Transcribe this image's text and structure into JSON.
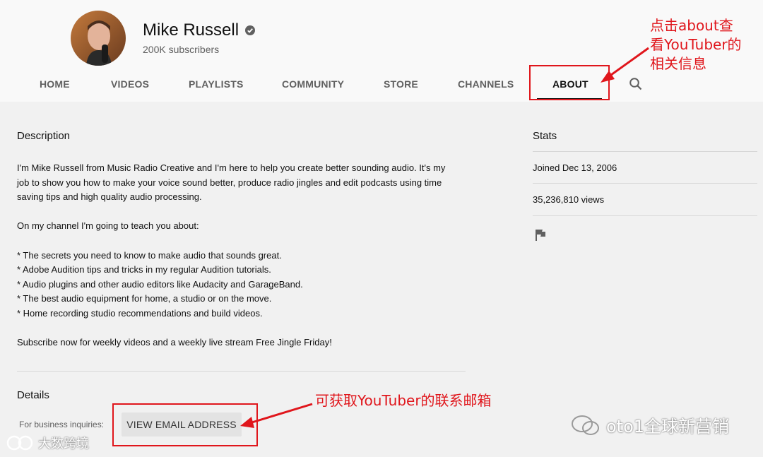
{
  "channel": {
    "name": "Mike Russell",
    "subscribers": "200K subscribers"
  },
  "tabs": [
    {
      "label": "HOME"
    },
    {
      "label": "VIDEOS"
    },
    {
      "label": "PLAYLISTS"
    },
    {
      "label": "COMMUNITY"
    },
    {
      "label": "STORE"
    },
    {
      "label": "CHANNELS"
    },
    {
      "label": "ABOUT",
      "active": true
    }
  ],
  "description": {
    "title": "Description",
    "lines": [
      "I'm Mike Russell from Music Radio Creative and I'm here to help you create better sounding audio. It's my",
      "job to show you how to make your voice sound better, produce radio jingles and edit podcasts using time",
      "saving tips and high quality audio processing.",
      "On my channel I'm going to teach you about:",
      "* The secrets you need to know to make audio that sounds great.",
      "* Adobe Audition tips and tricks in my regular Audition tutorials.",
      "* Audio plugins and other audio editors like Audacity and GarageBand.",
      "* The best audio equipment for home, a studio or on the move.",
      "* Home recording studio recommendations and build videos.",
      "Subscribe now for weekly videos and a weekly live stream Free Jingle Friday!"
    ]
  },
  "details": {
    "title": "Details",
    "business_label": "For business inquiries:",
    "email_button": "VIEW EMAIL ADDRESS"
  },
  "stats": {
    "title": "Stats",
    "joined": "Joined Dec 13, 2006",
    "views": "35,236,810 views"
  },
  "annotations": {
    "about_note": [
      "点击about查",
      "看YouTuber的",
      "相关信息"
    ],
    "email_note": "可获取YouTuber的联系邮箱",
    "color": "#e0161c"
  },
  "watermarks": {
    "right": "oto1全球新营销",
    "left": "大数跨境"
  },
  "icons": {
    "verified": "verified-check-icon",
    "search": "search-icon",
    "flag": "flag-icon"
  }
}
